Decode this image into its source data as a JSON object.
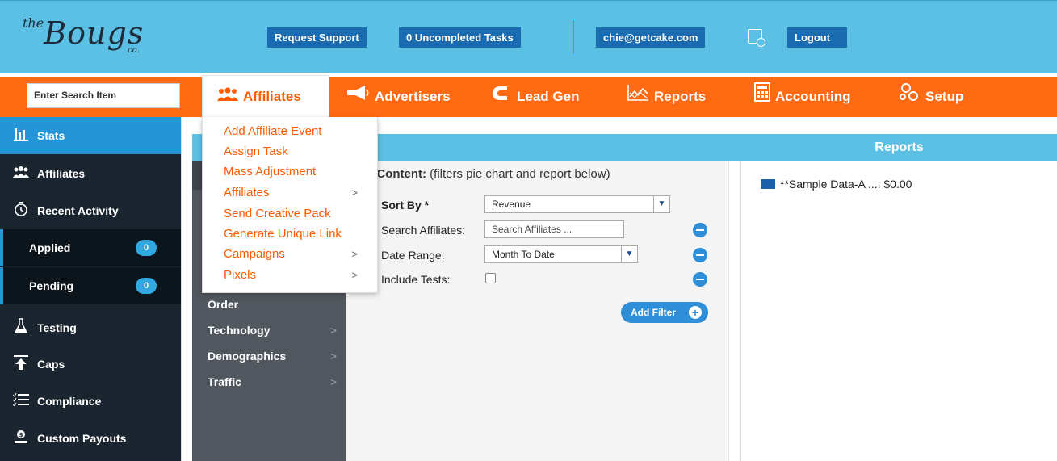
{
  "header": {
    "logo_the": "the",
    "logo_name": "Bougs",
    "logo_co": "co.",
    "request_support": "Request Support",
    "tasks": "0  Uncompleted Tasks",
    "email": "chie@getcake.com",
    "logout": "Logout",
    "accent": "#5bc0e4"
  },
  "nav": {
    "search_placeholder": "Enter Search Item",
    "items": [
      {
        "label": "Affiliates",
        "icon": "users-icon"
      },
      {
        "label": "Advertisers",
        "icon": "megaphone-icon"
      },
      {
        "label": "Lead Gen",
        "icon": "magnet-icon"
      },
      {
        "label": "Reports",
        "icon": "chart-line-icon"
      },
      {
        "label": "Accounting",
        "icon": "calculator-icon"
      },
      {
        "label": "Setup",
        "icon": "gears-icon"
      }
    ],
    "color": "#ff6a13"
  },
  "dropdown": {
    "items": [
      {
        "label": "Add Affiliate Event"
      },
      {
        "label": "Assign Task"
      },
      {
        "label": "Mass Adjustment"
      },
      {
        "label": "Affiliates",
        "chev": ">"
      },
      {
        "label": "Send Creative Pack"
      },
      {
        "label": "Generate Unique Link"
      },
      {
        "label": "Campaigns",
        "chev": ">"
      },
      {
        "label": "Pixels",
        "chev": ">"
      }
    ]
  },
  "sidebar": {
    "items": [
      {
        "label": "Stats",
        "icon": "bar-chart-icon"
      },
      {
        "label": "Affiliates",
        "icon": "users-icon"
      },
      {
        "label": "Recent Activity",
        "icon": "clock-icon"
      },
      {
        "label": "Applied",
        "badge": "0"
      },
      {
        "label": "Pending",
        "badge": "0"
      },
      {
        "label": "Testing",
        "icon": "flask-icon"
      },
      {
        "label": "Caps",
        "icon": "cap-arrow-icon"
      },
      {
        "label": "Compliance",
        "icon": "checklist-icon"
      },
      {
        "label": "Custom Payouts",
        "icon": "money-hand-icon"
      }
    ]
  },
  "submenu": {
    "items": [
      {
        "label": "Order"
      },
      {
        "label": "Technology",
        "chev": ">"
      },
      {
        "label": "Demographics",
        "chev": ">"
      },
      {
        "label": "Traffic",
        "chev": ">"
      }
    ]
  },
  "filters": {
    "header_bold": "er Content:",
    "header_note": "(filters pie chart and report below)",
    "sort_by_label": "Sort By *",
    "sort_by_value": "Revenue",
    "search_label": "Search Affiliates:",
    "search_placeholder": "Search Affiliates ...",
    "date_label": "Date Range:",
    "date_value": "Month To Date",
    "include_tests_label": "Include Tests:",
    "add_filter": "Add Filter"
  },
  "reports": {
    "title": "Reports",
    "legend_item": "**Sample Data-A ...: $0.00"
  }
}
